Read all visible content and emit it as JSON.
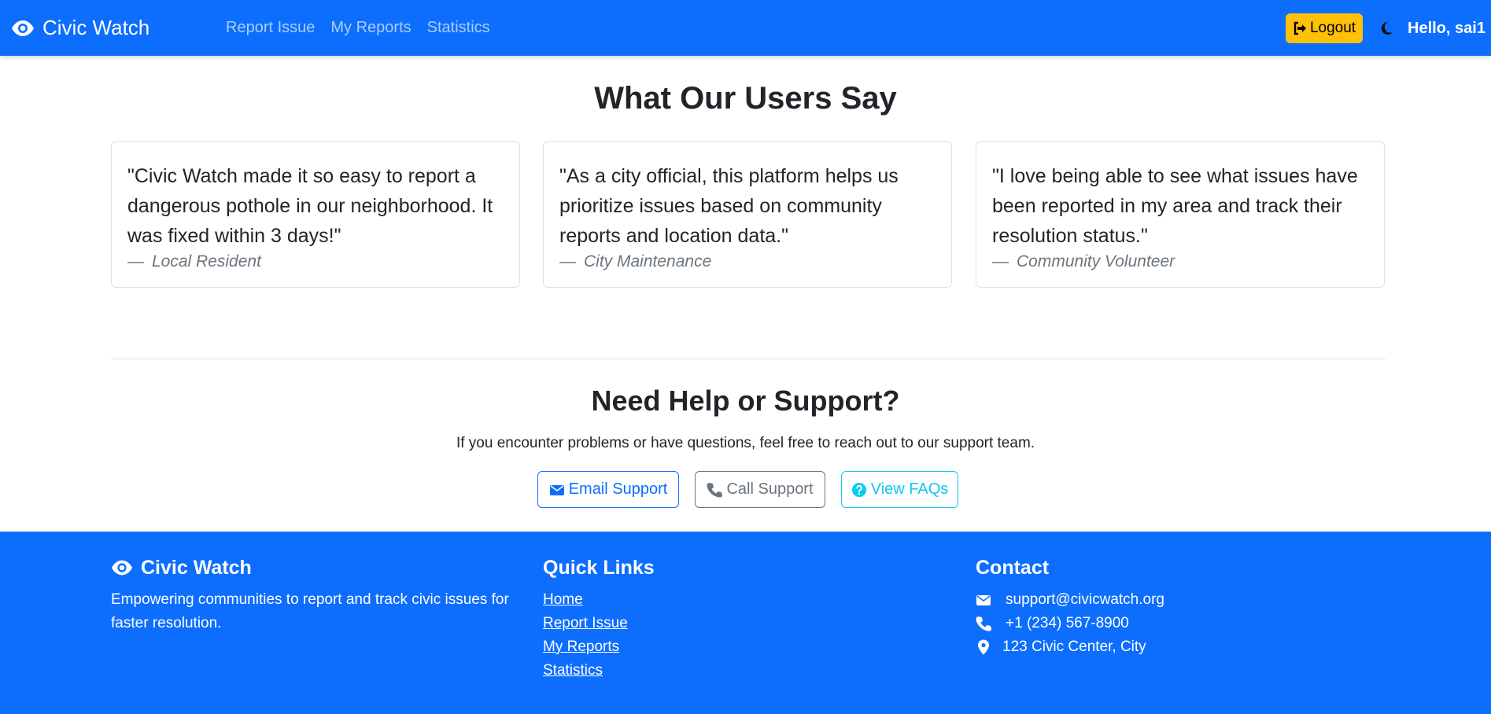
{
  "nav": {
    "brand": "Civic Watch",
    "links": [
      "Report Issue",
      "My Reports",
      "Statistics"
    ],
    "logout_label": "Logout",
    "greeting": "Hello, sai1"
  },
  "testimonials": {
    "title": "What Our Users Say",
    "items": [
      {
        "quote": "\"Civic Watch made it so easy to report a dangerous pothole in our neighborhood. It was fixed within 3 days!\"",
        "author": "Local Resident"
      },
      {
        "quote": "\"As a city official, this platform helps us prioritize issues based on community reports and location data.\"",
        "author": "City Maintenance"
      },
      {
        "quote": "\"I love being able to see what issues have been reported in my area and track their resolution status.\"",
        "author": "Community Volunteer"
      }
    ],
    "dash": "—"
  },
  "support": {
    "title": "Need Help or Support?",
    "text": "If you encounter problems or have questions, feel free to reach out to our support team.",
    "email_label": "Email Support",
    "call_label": "Call Support",
    "faq_label": "View FAQs"
  },
  "footer": {
    "brand": "Civic Watch",
    "tagline": "Empowering communities to report and track civic issues for faster resolution.",
    "quick_links_title": "Quick Links",
    "quick_links": [
      "Home",
      "Report Issue",
      "My Reports",
      "Statistics"
    ],
    "contact_title": "Contact",
    "email": "support@civicwatch.org",
    "phone": "+1 (234) 567-8900",
    "address": "123 Civic Center, City"
  },
  "colors": {
    "primary": "#0d6efd",
    "warning": "#ffc107",
    "secondary": "#6c757d",
    "info": "#0dcaf0"
  },
  "icons": [
    "eye-icon",
    "sign-out-icon",
    "moon-icon",
    "envelope-icon",
    "phone-icon",
    "question-circle-icon",
    "map-marker-icon"
  ]
}
